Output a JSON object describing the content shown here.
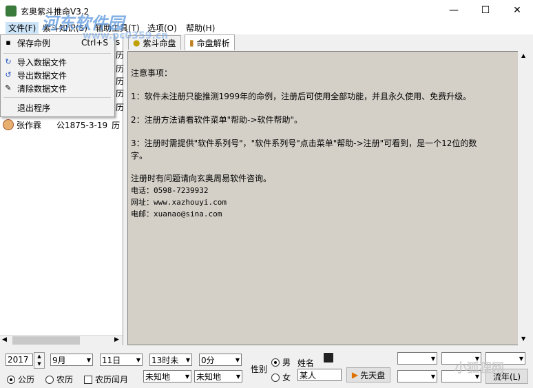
{
  "window": {
    "title": "玄奥紫斗推命V3.2",
    "minimize": "—",
    "maximize": "☐",
    "close": "✕"
  },
  "watermark": {
    "line1": "河东软件园",
    "line2": "www.pc0359.cn",
    "line3": "小狐狸网"
  },
  "menubar": {
    "file": "文件(F)",
    "knowledge": "紫斗知识(S)",
    "tools": "辅助工具(T)",
    "options": "选项(O)",
    "help": "帮助(H)"
  },
  "file_menu": {
    "save": "保存命例",
    "save_shortcut": "Ctrl+S",
    "import": "导入数据文件",
    "export": "导出数据文件",
    "clear": "清除数据文件",
    "exit": "退出程序"
  },
  "list": {
    "rows": [
      {
        "name": "张作霖",
        "date": "公1875-3-19",
        "tag": "历"
      }
    ],
    "partial_tags": [
      "历",
      "历",
      "历",
      "历",
      "历"
    ]
  },
  "tabs": [
    {
      "label": "紫斗命盘"
    },
    {
      "label": "命盘解析"
    }
  ],
  "tab_partial": "s",
  "content": {
    "heading": "注意事项：",
    "p1": "1：软件未注册只能推测1999年的命例，注册后可使用全部功能，并且永久使用、免费升级。",
    "p2": "2：注册方法请看软件菜单\"帮助->软件帮助\"。",
    "p3a": "3：注册时需提供\"软件系列号\"，\"软件系列号\"点击菜单\"帮助->注册\"可看到，是一个12位的数",
    "p3b": "字。",
    "contact": "注册时有问题请向玄奥周易软件咨询。",
    "phone": "电话：0598-7239932",
    "site": "网址：www.xazhouyi.com",
    "email": "电邮：xuanao@sina.com"
  },
  "controls": {
    "year": "2017",
    "month": "9月",
    "day": "11日",
    "hour": "13时未",
    "minute": "0分",
    "gender_label": "性别",
    "male": "男",
    "female": "女",
    "name_label": "姓名",
    "name_value": "某人",
    "xiantian_button": "先天盘",
    "liunian_button": "流年(L)",
    "solar": "公历",
    "lunar": "农历",
    "leap": "农历闰月",
    "unknown1": "未知地",
    "unknown2": "未知地"
  }
}
